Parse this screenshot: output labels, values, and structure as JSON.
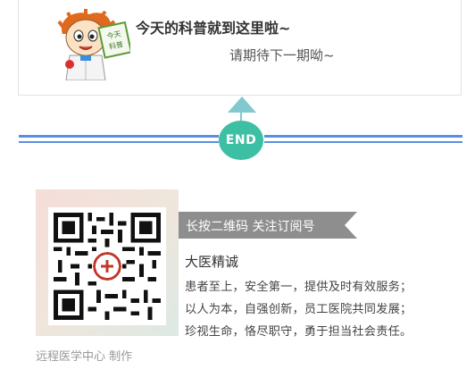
{
  "footer_card": {
    "title": "今天的科普就到这里啦~",
    "subtitle": "请期待下一期呦~",
    "mascot_sign": "今天的科普"
  },
  "divider": {
    "end_label": "END",
    "colors": {
      "line": "#5a8fe0",
      "badge": "#3dbfa3",
      "arrow": "#7fc9cf"
    }
  },
  "qr_section": {
    "ribbon_label": "长按二维码 关注订阅号",
    "org_name": "大医精诚",
    "motto_lines": [
      "患者至上，安全第一，提供及时有效服务；",
      "以人为本，自强创新，员工医院共同发展；",
      "珍视生命，恪尽职守，勇于担当社会责任。"
    ]
  },
  "maker_credit": "远程医学中心 制作",
  "icons": [
    "doctor-mascot-icon",
    "qr-code-icon",
    "hospital-logo-icon"
  ]
}
